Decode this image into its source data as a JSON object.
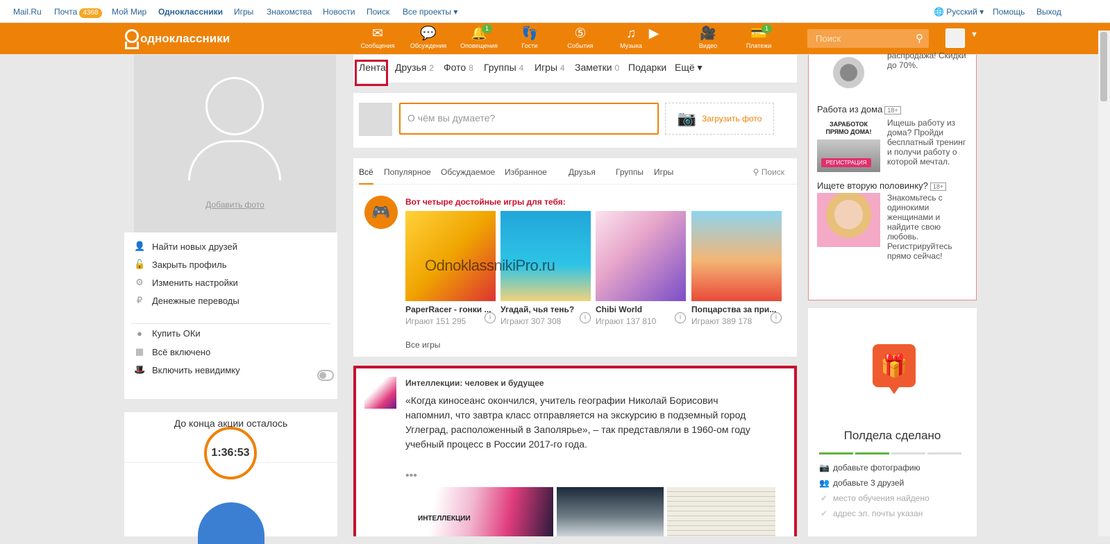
{
  "topbar": {
    "mailru": "Mail.Ru",
    "mail": "Почта",
    "mail_count": "4368",
    "mymir": "Мой Мир",
    "ok": "Одноклассники",
    "games": "Игры",
    "dating": "Знакомства",
    "news": "Новости",
    "search": "Поиск",
    "all_projects": "Все проекты ▾",
    "language": "Русский ▾",
    "help": "Помощь",
    "logout": "Выход"
  },
  "header": {
    "logo": "одноклассники",
    "nav": [
      {
        "label": "Сообщения",
        "icon": "envelope-icon",
        "glyph": "✉",
        "count": ""
      },
      {
        "label": "Обсуждения",
        "icon": "chat-icon",
        "glyph": "💬",
        "count": ""
      },
      {
        "label": "Оповещения",
        "icon": "bell-icon",
        "glyph": "🔔",
        "count": "1"
      },
      {
        "label": "Гости",
        "icon": "footprints-icon",
        "glyph": "👣",
        "count": ""
      },
      {
        "label": "События",
        "icon": "events-icon",
        "glyph": "⑤",
        "count": ""
      },
      {
        "label": "Музыка",
        "icon": "music-icon",
        "glyph": "♫",
        "count": ""
      },
      {
        "label": "",
        "icon": "play-icon",
        "glyph": "▶",
        "count": ""
      },
      {
        "label": "Видео",
        "icon": "video-camera-icon",
        "glyph": "🎥",
        "count": ""
      },
      {
        "label": "Платежи",
        "icon": "payments-icon",
        "glyph": "💳",
        "count": "1"
      }
    ],
    "search_placeholder": "Поиск"
  },
  "left": {
    "add_photo": "Добавить фото",
    "menu": [
      {
        "label": "Найти новых друзей",
        "icon": "person-icon",
        "glyph": "👤"
      },
      {
        "label": "Закрыть профиль",
        "icon": "lock-icon",
        "glyph": "🔓"
      },
      {
        "label": "Изменить настройки",
        "icon": "gear-icon",
        "glyph": "⚙"
      },
      {
        "label": "Денежные переводы",
        "icon": "money-transfer-icon",
        "glyph": "₽"
      },
      {
        "label": "Купить ОКи",
        "icon": "ok-coin-icon",
        "glyph": "●"
      },
      {
        "label": "Всё включено",
        "icon": "all-inclusive-icon",
        "glyph": "▦"
      },
      {
        "label": "Включить невидимку",
        "icon": "hat-icon",
        "glyph": "🎩"
      }
    ],
    "promo_title": "До конца акции осталось",
    "timer": "1:36:53"
  },
  "tabs": [
    {
      "label": "Лента",
      "count": ""
    },
    {
      "label": "Друзья",
      "count": "2"
    },
    {
      "label": "Фото",
      "count": "8"
    },
    {
      "label": "Группы",
      "count": "4"
    },
    {
      "label": "Игры",
      "count": "4"
    },
    {
      "label": "Заметки",
      "count": "0"
    },
    {
      "label": "Подарки",
      "count": ""
    },
    {
      "label": "Ещё ▾",
      "count": ""
    }
  ],
  "composer": {
    "placeholder": "О чём вы думаете?",
    "upload": "Загрузить фото"
  },
  "feed": {
    "filters": [
      "Всё",
      "Популярное",
      "Обсуждаемое",
      "Избранное",
      "Друзья",
      "Группы",
      "Игры"
    ],
    "search": "Поиск",
    "games_title": "Вот четыре достойные игры для тебя:",
    "games": [
      {
        "name": "PaperRacer - гонки ...",
        "players": "Играют 151 295"
      },
      {
        "name": "Угадай, чья тень?",
        "players": "Играют 307 308"
      },
      {
        "name": "Chibi World",
        "players": "Играют 137 810"
      },
      {
        "name": "Попцарства за при...",
        "players": "Играют 389 178"
      }
    ],
    "all_games": "Все игры"
  },
  "post": {
    "group": "Интеллекции: человек и будущее",
    "text": "«Когда киносеанс окончился, учитель географии Николай Борисович напомнил, что завтра класс отправляется на экскурсию в подземный город Углеград, расположенный в Заполярье», – так представляли в 1960-ом году учебный процесс в России 2017-го года.",
    "more": "•••",
    "image_label": "ИНТЕЛЛЕКЦИИ"
  },
  "watermark": "OdnoklassnikiPro.ru",
  "ads": [
    {
      "title": "",
      "age": "",
      "text": "распродажа! Скидки до 70%."
    },
    {
      "title": "Работа из дома",
      "age": "18+",
      "text": "Ищешь работу из дома? Пройди бесплатный тренинг и получи работу о которой мечтал.",
      "img_text": "ЗАРАБОТОК ПРЯМО ДОМА!",
      "img_btn": "РЕГИСТРАЦИЯ"
    },
    {
      "title": "Ищете вторую половинку?",
      "age": "18+",
      "text": "Знакомьтесь с одинокими женщинами и найдите свою любовь. Регистрируйтесь прямо сейчас!"
    }
  ],
  "progress": {
    "title": "Полдела сделано",
    "completed": 2,
    "total": 4,
    "items": [
      {
        "label": "добавьте фотографию",
        "icon": "camera-icon",
        "glyph": "📷",
        "done": false
      },
      {
        "label": "добавьте 3 друзей",
        "icon": "people-icon",
        "glyph": "👥",
        "done": false
      },
      {
        "label": "место обучения найдено",
        "icon": "check-icon",
        "glyph": "✔",
        "done": true
      },
      {
        "label": "адрес эл. почты указан",
        "icon": "check-icon",
        "glyph": "✔",
        "done": true
      }
    ]
  },
  "colors": {
    "brand": "#ee8208",
    "highlight": "#c8102e",
    "progress": "#5cb53c"
  }
}
